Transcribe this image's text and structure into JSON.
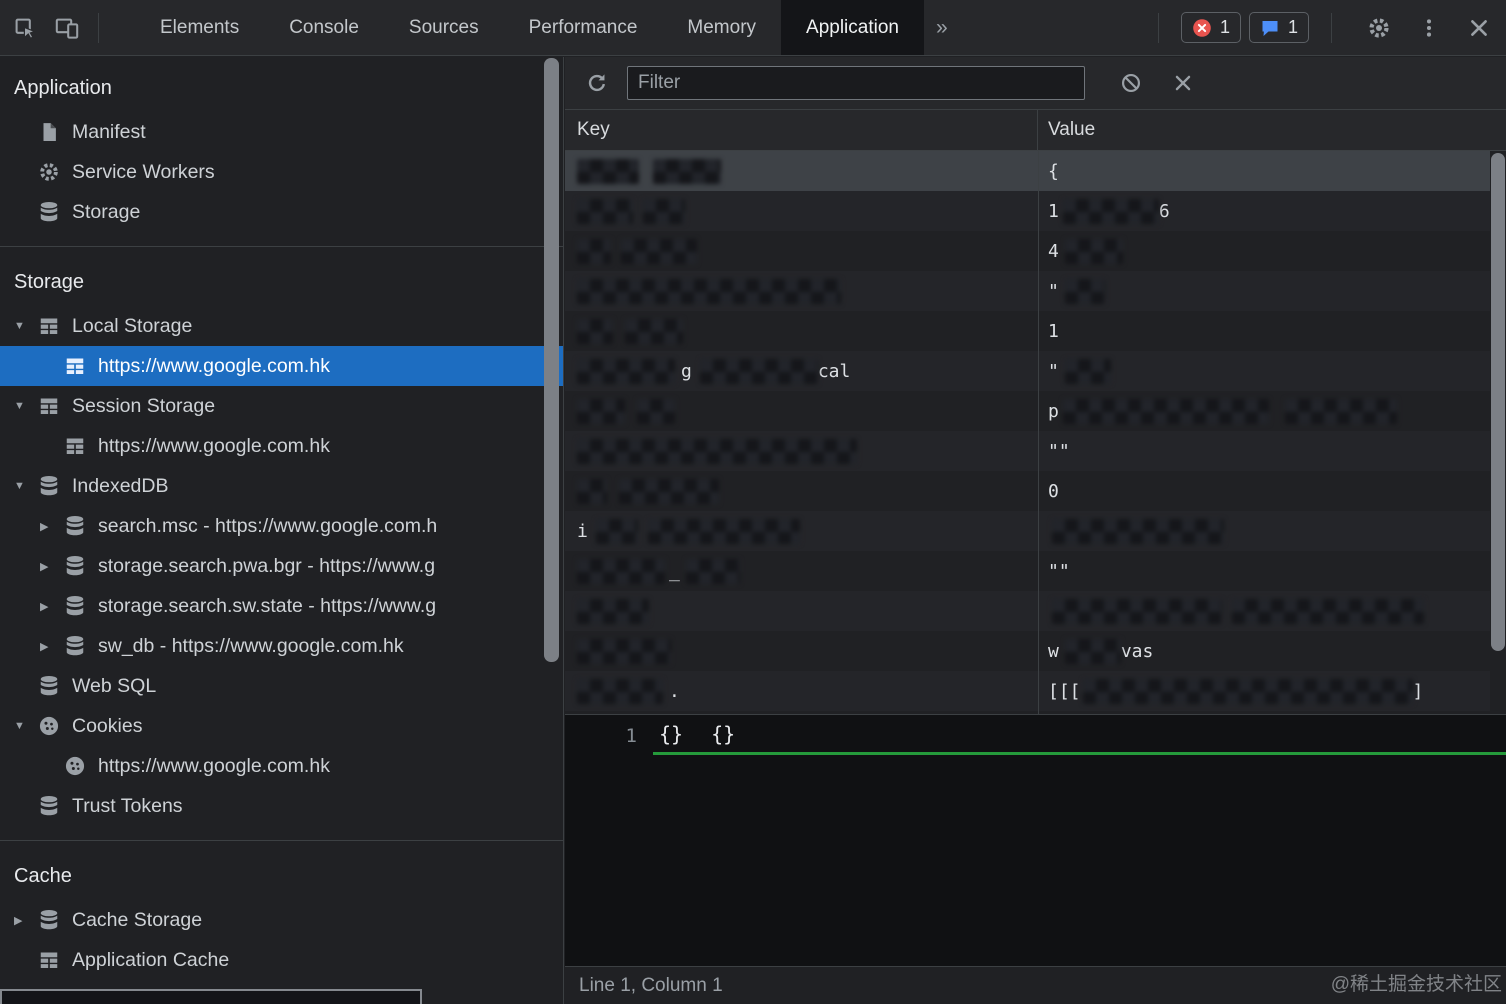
{
  "topbar": {
    "tabs": [
      "Elements",
      "Console",
      "Sources",
      "Performance",
      "Memory",
      "Application"
    ],
    "active": "Application",
    "more_label": "»",
    "error_count": "1",
    "message_count": "1",
    "error_color": "#e8544f",
    "message_color": "#4d8ef7"
  },
  "sidebar": {
    "sections": [
      {
        "title": "Application",
        "items": [
          {
            "label": "Manifest",
            "icon": "file"
          },
          {
            "label": "Service Workers",
            "icon": "gear"
          },
          {
            "label": "Storage",
            "icon": "database"
          }
        ]
      },
      {
        "title": "Storage",
        "items": [
          {
            "label": "Local Storage",
            "icon": "table",
            "disclosure": "open"
          },
          {
            "label": "https://www.google.com.hk",
            "icon": "table",
            "depth": 1,
            "selected": true
          },
          {
            "label": "Session Storage",
            "icon": "table",
            "disclosure": "open"
          },
          {
            "label": "https://www.google.com.hk",
            "icon": "table",
            "depth": 1
          },
          {
            "label": "IndexedDB",
            "icon": "database",
            "disclosure": "open"
          },
          {
            "label": "search.msc - https://www.google.com.h",
            "icon": "database",
            "depth": 1,
            "disclosure": "closed"
          },
          {
            "label": "storage.search.pwa.bgr - https://www.g",
            "icon": "database",
            "depth": 1,
            "disclosure": "closed"
          },
          {
            "label": "storage.search.sw.state - https://www.g",
            "icon": "database",
            "depth": 1,
            "disclosure": "closed"
          },
          {
            "label": "sw_db - https://www.google.com.hk",
            "icon": "database",
            "depth": 1,
            "disclosure": "closed"
          },
          {
            "label": "Web SQL",
            "icon": "database"
          },
          {
            "label": "Cookies",
            "icon": "cookie",
            "disclosure": "open"
          },
          {
            "label": "https://www.google.com.hk",
            "icon": "cookie",
            "depth": 1
          },
          {
            "label": "Trust Tokens",
            "icon": "database"
          }
        ]
      },
      {
        "title": "Cache",
        "items": [
          {
            "label": "Cache Storage",
            "icon": "database",
            "disclosure": "closed"
          },
          {
            "label": "Application Cache",
            "icon": "table"
          }
        ]
      }
    ]
  },
  "main": {
    "filter_placeholder": "Filter",
    "columns": [
      "Key",
      "Value"
    ],
    "selection_color": "#1d6dc1",
    "highlight_green": "#259b3b",
    "rows": [
      {
        "selected": true,
        "key": [
          {
            "b": 62
          },
          {
            "g": 14,
            "b": 68
          }
        ],
        "value": [
          {
            "t": "{"
          }
        ]
      },
      {
        "key": [
          {
            "b": 56
          },
          {
            "g": 10,
            "b": 42
          }
        ],
        "value": [
          {
            "t": "1"
          },
          {
            "g": 4,
            "b": 96
          },
          {
            "t": "6"
          }
        ]
      },
      {
        "key": [
          {
            "b": 34
          },
          {
            "g": 10,
            "b": 76
          }
        ],
        "value": [
          {
            "t": "4"
          },
          {
            "g": 6,
            "b": 58
          }
        ]
      },
      {
        "key": [
          {
            "b": 264
          }
        ],
        "value": [
          {
            "t": "\""
          },
          {
            "g": 6,
            "b": 40
          }
        ]
      },
      {
        "key": [
          {
            "b": 36
          },
          {
            "g": 12,
            "b": 58
          }
        ],
        "value": [
          {
            "t": "1"
          }
        ]
      },
      {
        "key": [
          {
            "b": 98
          },
          {
            "g": 6,
            "t": "g"
          },
          {
            "g": 8,
            "b": 118
          },
          {
            "t": "cal"
          }
        ],
        "value": [
          {
            "t": "\""
          },
          {
            "g": 6,
            "b": 46
          }
        ]
      },
      {
        "key": [
          {
            "b": 48
          },
          {
            "g": 12,
            "b": 38
          }
        ],
        "value": [
          {
            "t": "p"
          },
          {
            "g": 4,
            "b": 206
          },
          {
            "g": 16,
            "b": 112
          }
        ]
      },
      {
        "key": [
          {
            "b": 280
          }
        ],
        "value": [
          {
            "t": "\"\""
          }
        ]
      },
      {
        "key": [
          {
            "b": 30
          },
          {
            "g": 12,
            "b": 100
          }
        ],
        "value": [
          {
            "t": "0"
          }
        ]
      },
      {
        "key": [
          {
            "t": "i"
          },
          {
            "g": 8,
            "b": 42
          },
          {
            "g": 10,
            "b": 152
          }
        ],
        "value": [
          {
            "g": 4,
            "b": 172
          }
        ]
      },
      {
        "key": [
          {
            "b": 88
          },
          {
            "g": 4,
            "t": "_"
          },
          {
            "g": 6,
            "b": 54
          }
        ],
        "value": [
          {
            "t": "\"\""
          }
        ]
      },
      {
        "key": [
          {
            "b": 72
          }
        ],
        "value": [
          {
            "g": 4,
            "b": 170
          },
          {
            "g": 10,
            "b": 192
          }
        ]
      },
      {
        "key": [
          {
            "b": 94
          }
        ],
        "value": [
          {
            "t": "w"
          },
          {
            "g": 6,
            "b": 56
          },
          {
            "t": "vas"
          }
        ]
      },
      {
        "key": [
          {
            "b": 86
          },
          {
            "g": 6,
            "t": "."
          }
        ],
        "value": [
          {
            "t": "[[["
          },
          {
            "g": 2,
            "b": 330
          },
          {
            "t": "]"
          }
        ]
      }
    ],
    "preview": {
      "line_number": "1",
      "tokens": [
        "{}",
        "{}"
      ]
    },
    "status": "Line 1, Column 1"
  },
  "watermark": "@稀土掘金技术社区"
}
